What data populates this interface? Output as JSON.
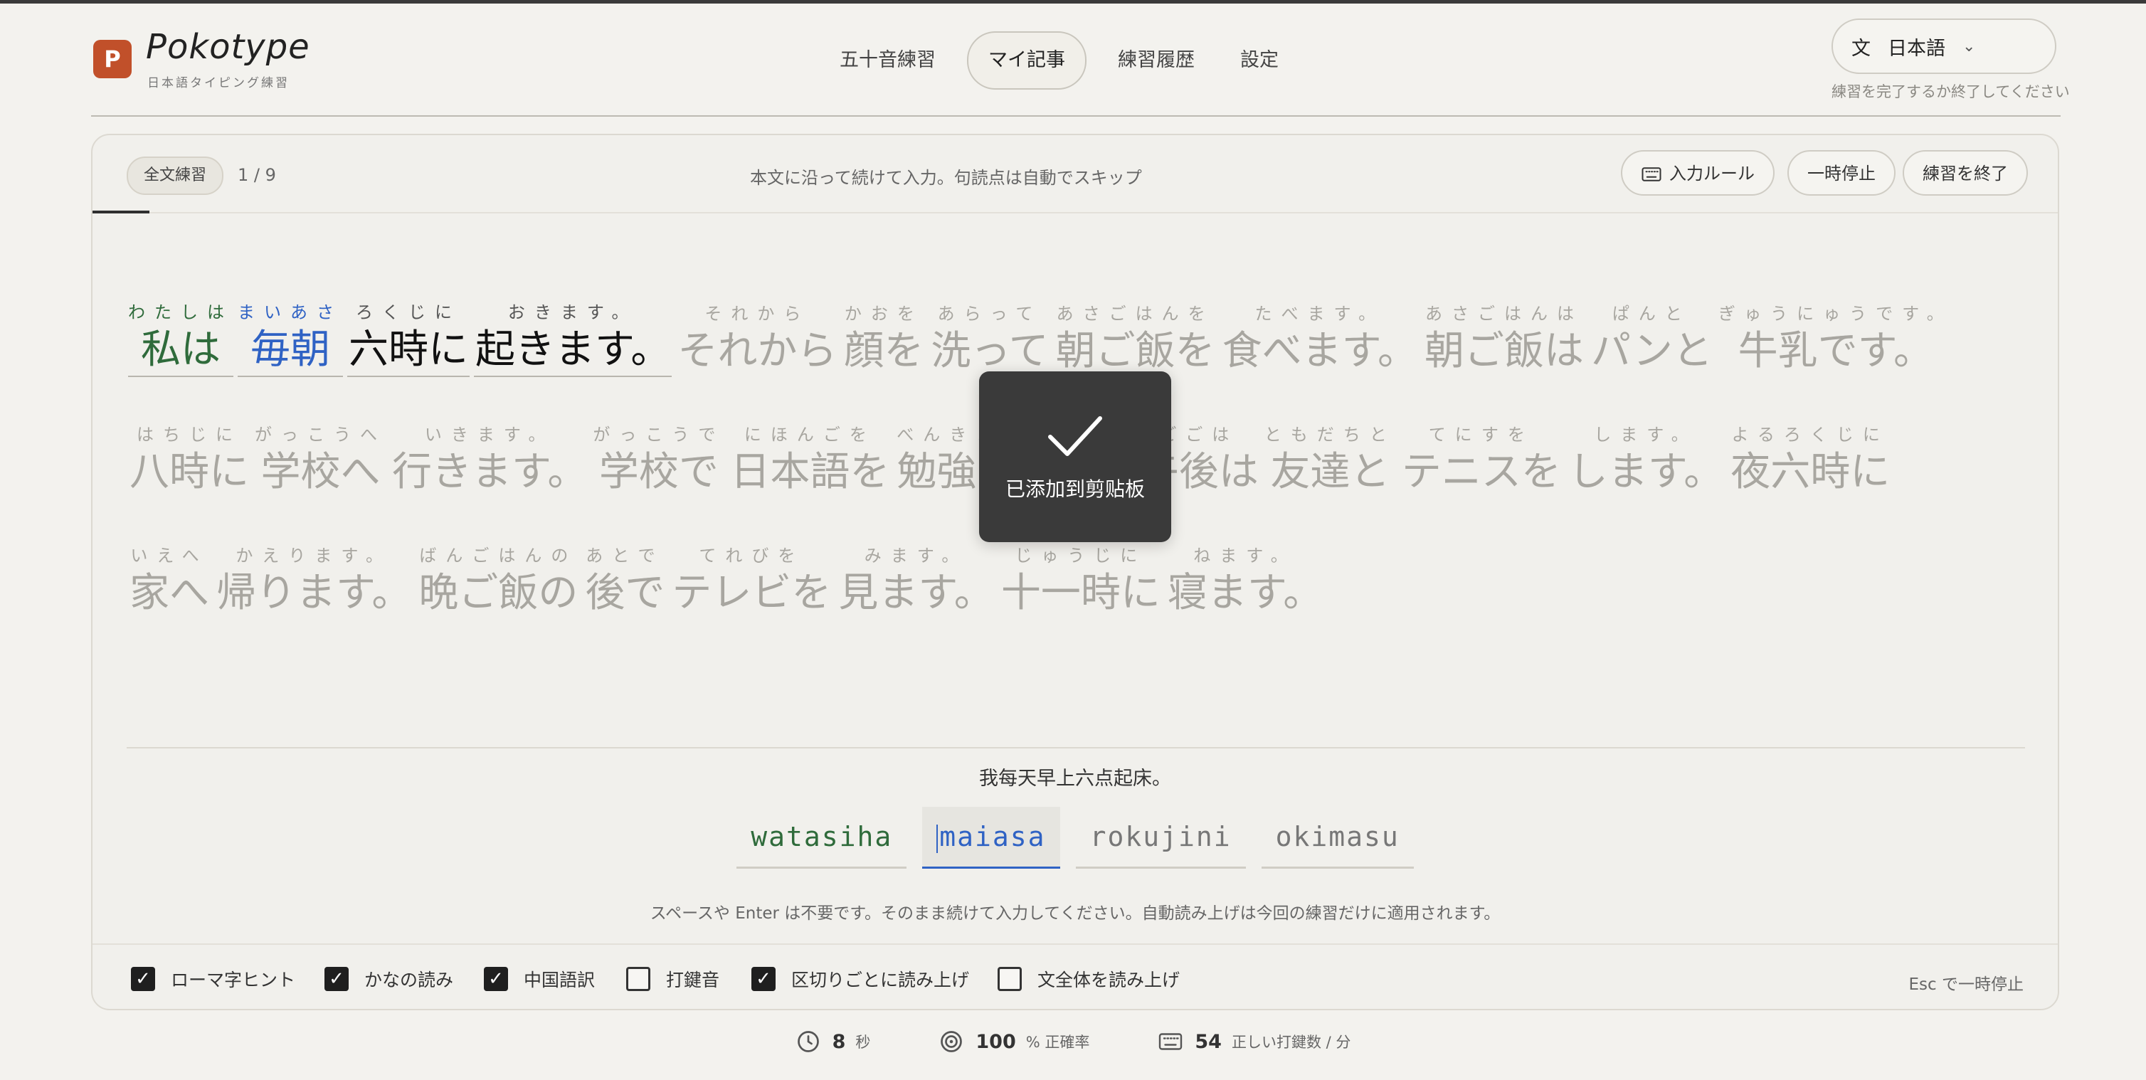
{
  "app": {
    "logo_glyph": "P",
    "name": "Pokotype",
    "tagline": "日本語タイピング練習"
  },
  "nav": [
    {
      "label": "五十音練習",
      "active": false
    },
    {
      "label": "マイ記事",
      "active": true
    },
    {
      "label": "練習履歴",
      "active": false
    },
    {
      "label": "設定",
      "active": false
    }
  ],
  "language": {
    "icon": "文",
    "label": "日本語",
    "chevron": "⌄",
    "hint": "練習を完了するか終了してください"
  },
  "practice": {
    "mode": "全文練習",
    "counter": "1 / 9",
    "instruction": "本文に沿って続けて入力。句読点は自動でスキップ",
    "buttons": {
      "input_rules": "入力ルール",
      "pause": "一時停止",
      "finish": "練習を終了"
    }
  },
  "text_lines": [
    [
      {
        "ruby": "わたしは",
        "base": "私は",
        "state": "done"
      },
      {
        "ruby": "まいあさ",
        "base": "毎朝",
        "state": "current"
      },
      {
        "ruby": "ろくじに",
        "base": "六時に",
        "state": "upcoming"
      },
      {
        "ruby": "おきます。",
        "base": "起きます。",
        "state": "upcoming"
      },
      {
        "ruby": "それから",
        "base": "それから",
        "state": "future"
      },
      {
        "ruby": "かおを",
        "base": "顔を",
        "state": "future"
      },
      {
        "ruby": "あらって",
        "base": "洗って",
        "state": "future"
      },
      {
        "ruby": "あさごはんを",
        "base": "朝ご飯を",
        "state": "future"
      },
      {
        "ruby": "たべます。",
        "base": "食べます。",
        "state": "future"
      },
      {
        "ruby": "あさごはんは",
        "base": "朝ご飯は",
        "state": "future"
      },
      {
        "ruby": "ぱんと",
        "base": "パンと",
        "state": "future"
      },
      {
        "ruby": "ぎゅうにゅうです。",
        "base": "牛乳です。",
        "state": "future"
      }
    ],
    [
      {
        "ruby": "はちじに",
        "base": "八時に",
        "state": "future"
      },
      {
        "ruby": "がっこうへ",
        "base": "学校へ",
        "state": "future"
      },
      {
        "ruby": "いきます。",
        "base": "行きます。",
        "state": "future"
      },
      {
        "ruby": "がっこうで",
        "base": "学校で",
        "state": "future"
      },
      {
        "ruby": "にほんごを",
        "base": "日本語を",
        "state": "future"
      },
      {
        "ruby": "べんきょうします。",
        "base": "勉強します。",
        "state": "future"
      },
      {
        "ruby": "ごごは",
        "base": "午後は",
        "state": "future"
      },
      {
        "ruby": "ともだちと",
        "base": "友達と",
        "state": "future"
      },
      {
        "ruby": "てにすを",
        "base": "テニスを",
        "state": "future"
      },
      {
        "ruby": "します。",
        "base": "します。",
        "state": "future"
      },
      {
        "ruby": "よるろくじに",
        "base": "夜六時に",
        "state": "future"
      }
    ],
    [
      {
        "ruby": "いえへ",
        "base": "家へ",
        "state": "future"
      },
      {
        "ruby": "かえります。",
        "base": "帰ります。",
        "state": "future"
      },
      {
        "ruby": "ばんごはんの",
        "base": "晩ご飯の",
        "state": "future"
      },
      {
        "ruby": "あとで",
        "base": "後で",
        "state": "future"
      },
      {
        "ruby": "てれびを",
        "base": "テレビを",
        "state": "future"
      },
      {
        "ruby": "みます。",
        "base": "見ます。",
        "state": "future"
      },
      {
        "ruby": "じゅうじに",
        "base": "十一時に",
        "state": "future"
      },
      {
        "ruby": "ねます。",
        "base": "寝ます。",
        "state": "future"
      }
    ]
  ],
  "translation": "我每天早上六点起床。",
  "romaji": [
    {
      "text": "watasiha",
      "state": "done"
    },
    {
      "text": "maiasa",
      "state": "current"
    },
    {
      "text": "rokujini",
      "state": "future"
    },
    {
      "text": "okimasu",
      "state": "future"
    }
  ],
  "input_hint": "スペースや Enter は不要です。そのまま続けて入力してください。自動読み上げは今回の練習だけに適用されます。",
  "options": [
    {
      "label": "ローマ字ヒント",
      "checked": true
    },
    {
      "label": "かなの読み",
      "checked": true
    },
    {
      "label": "中国語訳",
      "checked": true
    },
    {
      "label": "打鍵音",
      "checked": false
    },
    {
      "label": "区切りごとに読み上げ",
      "checked": true
    },
    {
      "label": "文全体を読み上げ",
      "checked": false
    }
  ],
  "esc_hint": "Esc で一時停止",
  "stats": {
    "time_value": "8",
    "time_unit": "秒",
    "accuracy_value": "100",
    "accuracy_unit": "% 正確率",
    "speed_value": "54",
    "speed_unit": "正しい打鍵数 / 分"
  },
  "toast": {
    "icon": "check-icon",
    "message": "已添加到剪贴板"
  },
  "colors": {
    "accent": "#c1502a",
    "done": "#2f6b3b",
    "current": "#2f62c4"
  }
}
